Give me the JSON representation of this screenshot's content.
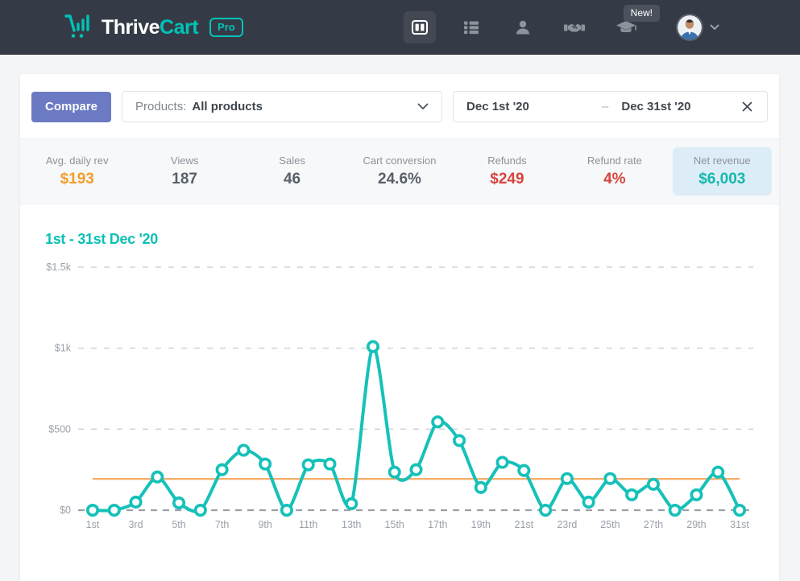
{
  "header": {
    "brand": {
      "thrive": "Thrive",
      "cart": "Cart",
      "badge": "Pro"
    },
    "new_badge": "New!",
    "nav_icons": [
      "dashboard-icon",
      "products-list-icon",
      "user-icon",
      "affiliates-handshake-icon",
      "learn-graduation-cap-icon"
    ]
  },
  "filters": {
    "compare_label": "Compare",
    "products_label": "Products:",
    "products_value": "All products",
    "date_start": "Dec 1st '20",
    "date_separator": "–",
    "date_end": "Dec 31st '20"
  },
  "stats": [
    {
      "label": "Avg. daily rev",
      "value": "$193",
      "color": "#f59d29",
      "highlighted": false
    },
    {
      "label": "Views",
      "value": "187",
      "color": "#596069",
      "highlighted": false
    },
    {
      "label": "Sales",
      "value": "46",
      "color": "#596069",
      "highlighted": false
    },
    {
      "label": "Cart conversion",
      "value": "24.6%",
      "color": "#596069",
      "highlighted": false
    },
    {
      "label": "Refunds",
      "value": "$249",
      "color": "#d6453c",
      "highlighted": false
    },
    {
      "label": "Refund rate",
      "value": "4%",
      "color": "#d6453c",
      "highlighted": false
    },
    {
      "label": "Net revenue",
      "value": "$6,003",
      "color": "#14b8ae",
      "highlighted": true
    }
  ],
  "chart_data": {
    "type": "line",
    "title": "1st - 31st Dec '20",
    "xlabel": "",
    "ylabel": "",
    "x": [
      1,
      2,
      3,
      4,
      5,
      6,
      7,
      8,
      9,
      10,
      11,
      12,
      13,
      14,
      15,
      16,
      17,
      18,
      19,
      20,
      21,
      22,
      23,
      24,
      25,
      26,
      27,
      28,
      29,
      30,
      31
    ],
    "x_tick_labels": [
      "1st",
      "3rd",
      "5th",
      "7th",
      "9th",
      "11th",
      "13th",
      "15th",
      "17th",
      "19th",
      "21st",
      "23rd",
      "25th",
      "27th",
      "29th",
      "31st"
    ],
    "values": [
      0,
      0,
      50,
      205,
      45,
      0,
      250,
      370,
      285,
      0,
      280,
      285,
      40,
      1010,
      235,
      250,
      545,
      430,
      140,
      295,
      245,
      0,
      195,
      50,
      195,
      95,
      160,
      0,
      95,
      235,
      0
    ],
    "average_line": 193,
    "ylim": [
      0,
      1500
    ],
    "y_ticks": [
      {
        "value": 0,
        "label": "$0"
      },
      {
        "value": 500,
        "label": "$500"
      },
      {
        "value": 1000,
        "label": "$1k"
      },
      {
        "value": 1500,
        "label": "$1.5k"
      }
    ],
    "grid": "dashed horizontal",
    "legend_position": "none",
    "colors": {
      "line": "#16c1b9",
      "point_fill": "#ffffff",
      "average": "#f6ad69",
      "grid": "#d0d4d9",
      "zero_line": "#9aa0a7",
      "tick_text": "#9aa1a9"
    }
  }
}
